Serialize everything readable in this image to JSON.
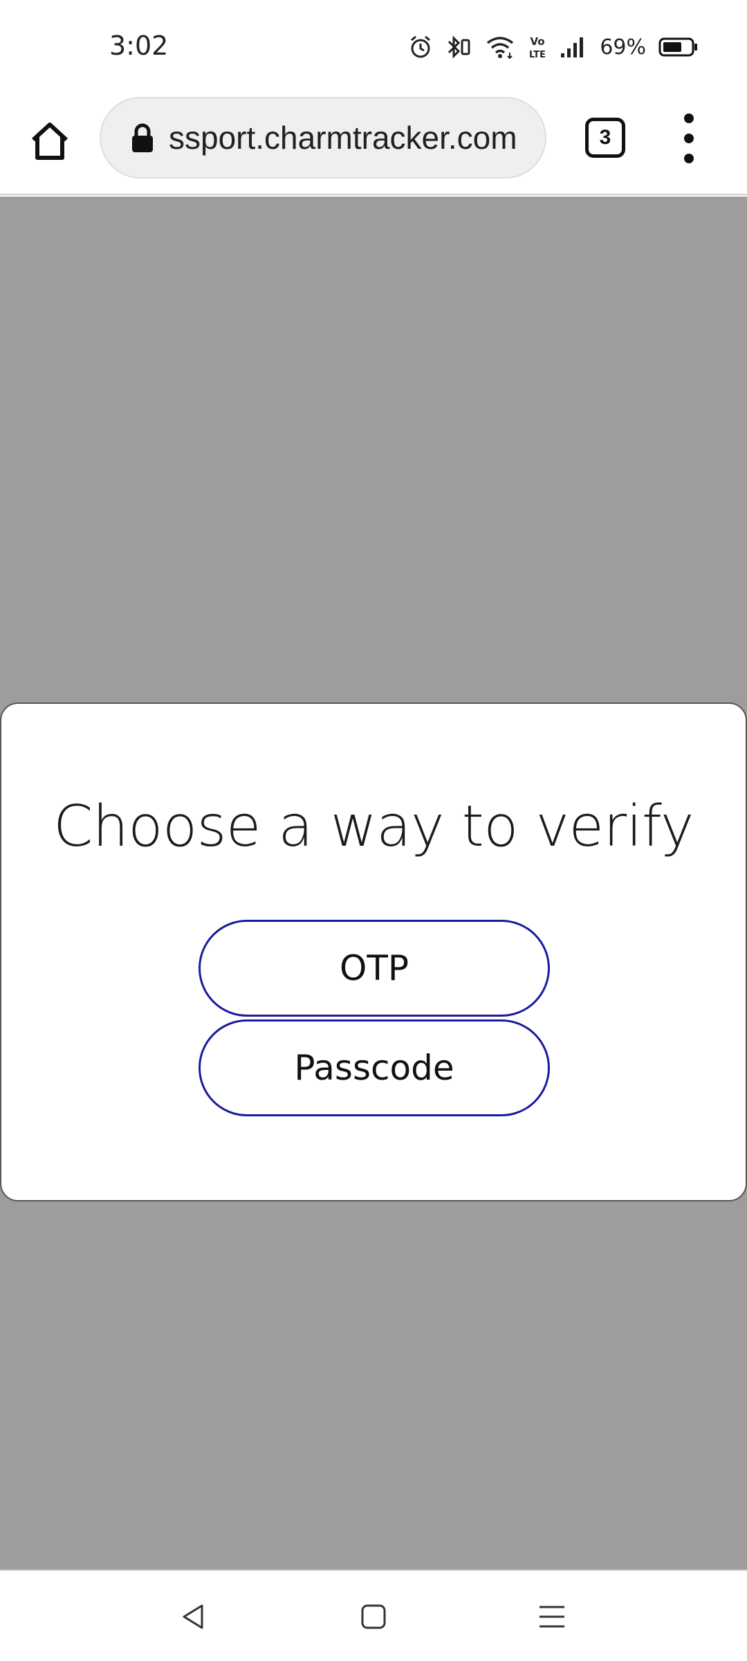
{
  "status_bar": {
    "time": "3:02",
    "battery_percent": "69%",
    "icons": [
      "alarm-icon",
      "bluetooth-icon",
      "wifi-icon",
      "volte-icon",
      "signal-icon",
      "battery-icon"
    ],
    "battery_level": 0.69,
    "volte_label_top": "Vo",
    "volte_label_bottom": "LTE"
  },
  "browser": {
    "url": "ssport.charmtracker.com",
    "tab_count": "3",
    "icons": [
      "home-icon",
      "lock-icon",
      "tabs-icon",
      "more-vert-icon"
    ]
  },
  "dialog": {
    "title": "Choose a way to verify",
    "options": [
      {
        "label": "OTP"
      },
      {
        "label": "Passcode"
      }
    ]
  },
  "nav_bar": {
    "icons": [
      "back-icon",
      "home-square-icon",
      "recents-icon"
    ]
  },
  "colors": {
    "overlay": "#9d9d9d",
    "button_border": "#1a1aa0",
    "card_bg": "#ffffff"
  }
}
